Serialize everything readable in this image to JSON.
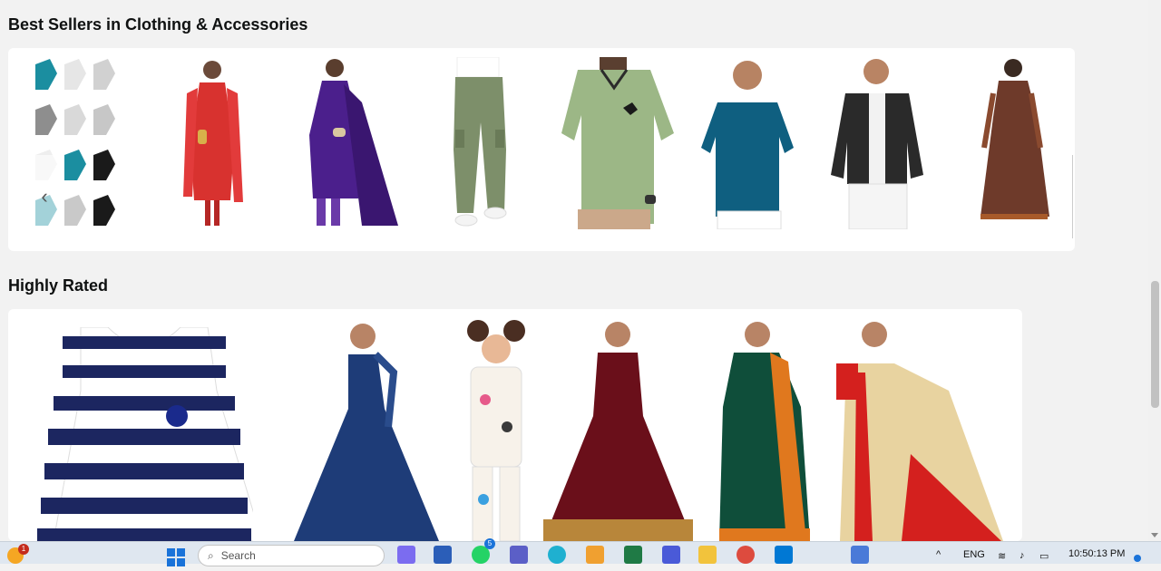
{
  "sections": {
    "best_sellers": {
      "title": "Best Sellers in Clothing & Accessories",
      "products": [
        {
          "name": "Ankle socks pack"
        },
        {
          "name": "Red kurta set"
        },
        {
          "name": "Purple kurta set"
        },
        {
          "name": "Cargo trousers"
        },
        {
          "name": "Green polo t-shirt"
        },
        {
          "name": "Teal polo t-shirt"
        },
        {
          "name": "Black jacket"
        },
        {
          "name": "Printed anarkali"
        }
      ]
    },
    "highly_rated": {
      "title": "Highly Rated",
      "products": [
        {
          "name": "Striped frock"
        },
        {
          "name": "Blue girls gown"
        },
        {
          "name": "Kids night suit"
        },
        {
          "name": "Maroon girls gown"
        },
        {
          "name": "Green silk saree"
        },
        {
          "name": "Cream printed saree"
        }
      ]
    }
  },
  "carousel": {
    "prev_icon": "chevron-left-icon",
    "prev_glyph": "‹"
  },
  "taskbar": {
    "search_placeholder": "Search",
    "notification_count": "1",
    "whatsapp_badge": "5",
    "language": "ENG",
    "time": "10:50:13 PM"
  },
  "colors": {
    "page_bg": "#f2f2f2",
    "card_bg": "#ffffff",
    "taskbar_bg": "#dfe7f0"
  }
}
